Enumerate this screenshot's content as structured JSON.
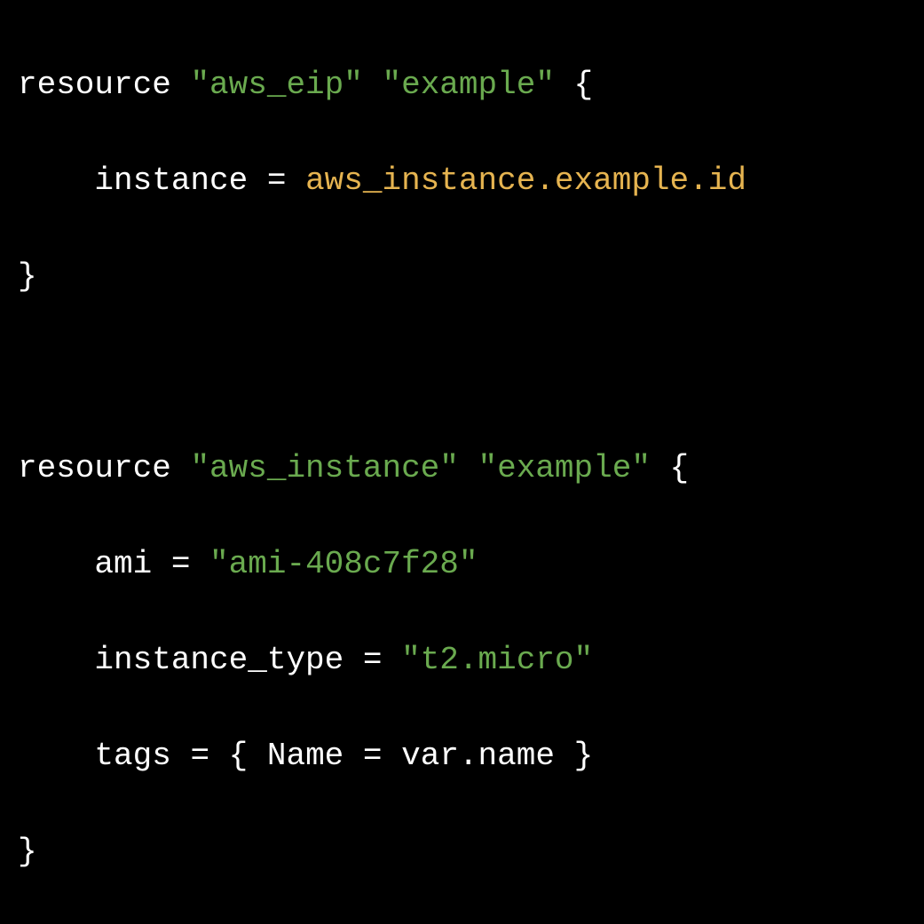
{
  "line1": {
    "keyword": "resource",
    "string1": "\"aws_eip\"",
    "string2": "\"example\"",
    "brace": "{"
  },
  "line2": {
    "attribute": "instance",
    "equals": "=",
    "reference": "aws_instance.example.id"
  },
  "line3": {
    "brace": "}"
  },
  "line5": {
    "keyword": "resource",
    "string1": "\"aws_instance\"",
    "string2": "\"example\"",
    "brace": "{"
  },
  "line6": {
    "attribute": "ami",
    "equals": "=",
    "string": "\"ami-408c7f28\""
  },
  "line7": {
    "attribute": "instance_type",
    "equals": "=",
    "string": "\"t2.micro\""
  },
  "line8": {
    "attribute": "tags",
    "equals": "=",
    "braceOpen": "{",
    "key": "Name",
    "keyEquals": "=",
    "value": "var.name",
    "braceClose": "}"
  },
  "line9": {
    "brace": "}"
  }
}
